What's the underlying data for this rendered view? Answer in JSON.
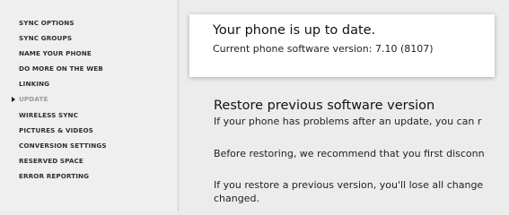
{
  "sidebar": {
    "items": [
      {
        "label": "SYNC OPTIONS"
      },
      {
        "label": "SYNC GROUPS"
      },
      {
        "label": "NAME YOUR PHONE"
      },
      {
        "label": "DO MORE ON THE WEB"
      },
      {
        "label": "LINKING"
      },
      {
        "label": "UPDATE",
        "active": true
      },
      {
        "label": "WIRELESS SYNC"
      },
      {
        "label": "PICTURES & VIDEOS"
      },
      {
        "label": "CONVERSION SETTINGS"
      },
      {
        "label": "RESERVED SPACE"
      },
      {
        "label": "ERROR REPORTING"
      }
    ]
  },
  "status": {
    "title": "Your phone is up to date.",
    "subtitle": "Current phone software version: 7.10 (8107)"
  },
  "restore": {
    "title": "Restore previous software version",
    "para1": "If your phone has problems after an update, you can r",
    "para2": "Before restoring, we recommend that you first disconn",
    "para3_line1": "If you restore a previous version, you'll lose all change",
    "para3_line2": "changed."
  },
  "colors": {
    "sidebar_bg": "#efefef",
    "main_bg": "#ececec",
    "card_bg": "#ffffff",
    "active_item": "#9a9a9a"
  },
  "icons": {
    "active_marker": "triangle-right-icon"
  }
}
